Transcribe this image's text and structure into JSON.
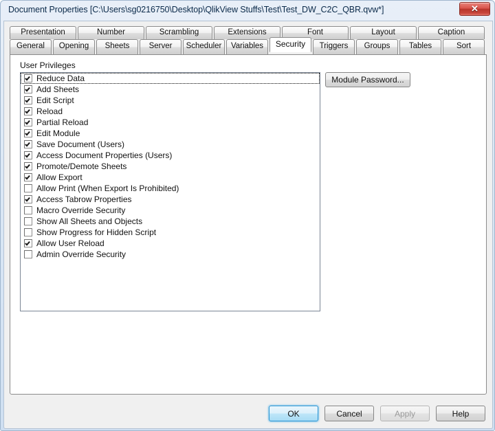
{
  "window": {
    "title": "Document Properties [C:\\Users\\sg0216750\\Desktop\\QlikView Stuffs\\Test\\Test_DW_C2C_QBR.qvw*]",
    "close_glyph": "✕",
    "accent_color": "#2c96d4",
    "close_color": "#c8463c"
  },
  "tabs": {
    "top_row": [
      {
        "label": "Presentation"
      },
      {
        "label": "Number"
      },
      {
        "label": "Scrambling"
      },
      {
        "label": "Extensions"
      },
      {
        "label": "Font"
      },
      {
        "label": "Layout"
      },
      {
        "label": "Caption"
      }
    ],
    "bottom_row": [
      {
        "label": "General",
        "active": false
      },
      {
        "label": "Opening",
        "active": false
      },
      {
        "label": "Sheets",
        "active": false
      },
      {
        "label": "Server",
        "active": false
      },
      {
        "label": "Scheduler",
        "active": false
      },
      {
        "label": "Variables",
        "active": false
      },
      {
        "label": "Security",
        "active": true
      },
      {
        "label": "Triggers",
        "active": false
      },
      {
        "label": "Groups",
        "active": false
      },
      {
        "label": "Tables",
        "active": false
      },
      {
        "label": "Sort",
        "active": false
      }
    ],
    "selected": "Security"
  },
  "panel": {
    "group_label": "User Privileges",
    "module_password_label": "Module Password...",
    "privileges": [
      {
        "label": "Reduce Data",
        "checked": true,
        "focused": true
      },
      {
        "label": "Add Sheets",
        "checked": true,
        "focused": false
      },
      {
        "label": "Edit Script",
        "checked": true,
        "focused": false
      },
      {
        "label": "Reload",
        "checked": true,
        "focused": false
      },
      {
        "label": "Partial Reload",
        "checked": true,
        "focused": false
      },
      {
        "label": "Edit Module",
        "checked": true,
        "focused": false
      },
      {
        "label": "Save Document (Users)",
        "checked": true,
        "focused": false
      },
      {
        "label": "Access Document Properties (Users)",
        "checked": true,
        "focused": false
      },
      {
        "label": "Promote/Demote Sheets",
        "checked": true,
        "focused": false
      },
      {
        "label": "Allow Export",
        "checked": true,
        "focused": false
      },
      {
        "label": "Allow Print (When Export Is Prohibited)",
        "checked": false,
        "focused": false
      },
      {
        "label": "Access Tabrow Properties",
        "checked": true,
        "focused": false
      },
      {
        "label": "Macro Override Security",
        "checked": false,
        "focused": false
      },
      {
        "label": "Show All Sheets and Objects",
        "checked": false,
        "focused": false
      },
      {
        "label": "Show Progress for Hidden Script",
        "checked": false,
        "focused": false
      },
      {
        "label": "Allow User Reload",
        "checked": true,
        "focused": false
      },
      {
        "label": "Admin Override Security",
        "checked": false,
        "focused": false
      }
    ]
  },
  "footer": {
    "ok_label": "OK",
    "cancel_label": "Cancel",
    "apply_label": "Apply",
    "help_label": "Help",
    "apply_enabled": false
  }
}
